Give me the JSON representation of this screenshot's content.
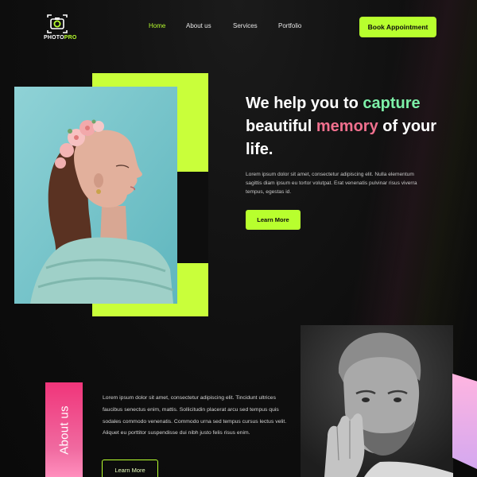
{
  "brand": {
    "name_part1": "PHOTO",
    "name_part2": "PRO"
  },
  "nav": {
    "items": [
      {
        "label": "Home",
        "active": true
      },
      {
        "label": "About us",
        "active": false
      },
      {
        "label": "Services",
        "active": false
      },
      {
        "label": "Portfolio",
        "active": false
      }
    ],
    "cta_label": "Book Appointment"
  },
  "hero": {
    "headline_line1_a": "We help you to ",
    "headline_line1_b": "capture",
    "headline_line2_a": "beautiful ",
    "headline_line2_b": "memory",
    "headline_line2_c": " of your",
    "headline_line3": "life.",
    "paragraph": "Lorem ipsum dolor sit amet, consectetur adipiscing elit. Nulla elementum sagittis diam ipsum eu tortor volutpat. Erat venenatis pulvinar risus viverra tempus, egestas id.",
    "button_label": "Learn More"
  },
  "about": {
    "tag_label": "About us",
    "paragraph": "Lorem ipsum dolor sit amet, consectetur adipiscing elit. Tincidunt ultrices faucibus senectus enim, mattis. Sollicitudin placerat arcu sed tempus quis sodales commodo venenatis. Commodo urna sed tempus cursus lectus velit. Aliquet eu porttitor suspendisse dui nibh justo felis risus enim.",
    "button_label": "Learn More"
  },
  "colors": {
    "accent_green": "#b8ff2e",
    "highlight_green": "#7df0a8",
    "highlight_pink": "#f0708e",
    "about_tag_pink": "#f0357a",
    "background": "#0e0e0e"
  },
  "icons": {
    "logo": "camera-icon"
  }
}
